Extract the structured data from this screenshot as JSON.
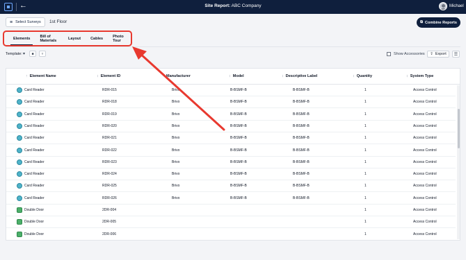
{
  "app": {
    "back_icon": "arrow-left",
    "title_prefix": "Site Report:",
    "title_company": "ABC Company",
    "user_name": "Michael"
  },
  "header": {
    "select_surveys_label": "Select Surveys",
    "floor_label": "1st Floor",
    "combine_reports_label": "Combine Reports"
  },
  "tabs": [
    {
      "label": "Elements",
      "active": true
    },
    {
      "label": "Bill of Materials",
      "active": false
    },
    {
      "label": "Layout",
      "active": false
    },
    {
      "label": "Cables",
      "active": false
    },
    {
      "label": "Photo Tour",
      "active": false
    }
  ],
  "toolbar": {
    "template_label": "Template:",
    "show_accessories_label": "Show Accessories",
    "show_accessories_checked": false,
    "export_label": "Export"
  },
  "table": {
    "columns": [
      "Element Name",
      "Element ID",
      "Manufacturer",
      "Model",
      "Descriptive Label",
      "Quantity",
      "System Type"
    ],
    "rows": [
      {
        "icon": "reader",
        "name": "Card Reader",
        "id": "RDR-015",
        "manufacturer": "Brivo",
        "model": "B-BSMF-B",
        "label": "B-BSMF-B",
        "qty": "1",
        "system": "Access Control"
      },
      {
        "icon": "reader",
        "name": "Card Reader",
        "id": "RDR-018",
        "manufacturer": "Brivo",
        "model": "B-BSMF-B",
        "label": "B-BSMF-B",
        "qty": "1",
        "system": "Access Control"
      },
      {
        "icon": "reader",
        "name": "Card Reader",
        "id": "RDR-019",
        "manufacturer": "Brivo",
        "model": "B-BSMF-B",
        "label": "B-BSMF-B",
        "qty": "1",
        "system": "Access Control"
      },
      {
        "icon": "reader",
        "name": "Card Reader",
        "id": "RDR-020",
        "manufacturer": "Brivo",
        "model": "B-BSMF-B",
        "label": "B-BSMF-B",
        "qty": "1",
        "system": "Access Control"
      },
      {
        "icon": "reader",
        "name": "Card Reader",
        "id": "RDR-021",
        "manufacturer": "Brivo",
        "model": "B-BSMF-B",
        "label": "B-BSMF-B",
        "qty": "1",
        "system": "Access Control"
      },
      {
        "icon": "reader",
        "name": "Card Reader",
        "id": "RDR-022",
        "manufacturer": "Brivo",
        "model": "B-BSMF-B",
        "label": "B-BSMF-B",
        "qty": "1",
        "system": "Access Control"
      },
      {
        "icon": "reader",
        "name": "Card Reader",
        "id": "RDR-023",
        "manufacturer": "Brivo",
        "model": "B-BSMF-B",
        "label": "B-BSMF-B",
        "qty": "1",
        "system": "Access Control"
      },
      {
        "icon": "reader",
        "name": "Card Reader",
        "id": "RDR-024",
        "manufacturer": "Brivo",
        "model": "B-BSMF-B",
        "label": "B-BSMF-B",
        "qty": "1",
        "system": "Access Control"
      },
      {
        "icon": "reader",
        "name": "Card Reader",
        "id": "RDR-025",
        "manufacturer": "Brivo",
        "model": "B-BSMF-B",
        "label": "B-BSMF-B",
        "qty": "1",
        "system": "Access Control"
      },
      {
        "icon": "reader",
        "name": "Card Reader",
        "id": "RDR-026",
        "manufacturer": "Brivo",
        "model": "B-BSMF-B",
        "label": "B-BSMF-B",
        "qty": "1",
        "system": "Access Control"
      },
      {
        "icon": "door",
        "name": "Double Door",
        "id": "2DR-004",
        "manufacturer": "",
        "model": "",
        "label": "",
        "qty": "1",
        "system": "Access Control"
      },
      {
        "icon": "door",
        "name": "Double Door",
        "id": "2DR-005",
        "manufacturer": "",
        "model": "",
        "label": "",
        "qty": "1",
        "system": "Access Control"
      },
      {
        "icon": "door",
        "name": "Double Door",
        "id": "2DR-006",
        "manufacturer": "",
        "model": "",
        "label": "",
        "qty": "1",
        "system": "Access Control"
      }
    ]
  },
  "colors": {
    "navy": "#0f1f3d",
    "annotation_red": "#e8392f",
    "reader_icon": "#4fb3c9",
    "door_icon": "#4caf6a"
  }
}
